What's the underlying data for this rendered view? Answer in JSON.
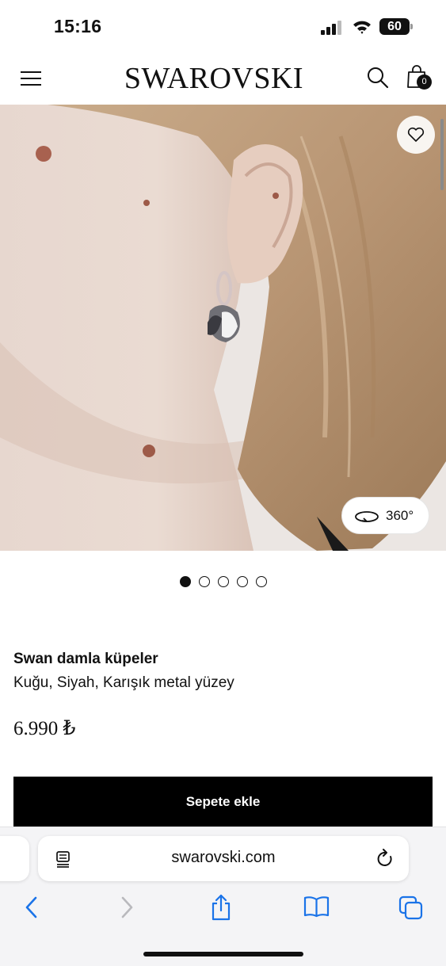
{
  "status_bar": {
    "time": "15:16",
    "battery": "60"
  },
  "header": {
    "brand": "SWAROVSKI",
    "cart_count": "0"
  },
  "gallery": {
    "view_360_label": "360°",
    "total_images": 5,
    "active_index": 0
  },
  "product": {
    "name": "Swan damla küpeler",
    "variant": "Kuğu, Siyah, Karışık metal yüzey",
    "price": "6.990 ₺"
  },
  "cta": {
    "add_to_cart_label": "Sepete ekle"
  },
  "browser": {
    "url": "swarovski.com"
  },
  "colors": {
    "primary": "#000000",
    "background": "#ffffff",
    "browser_bar": "#f4f4f6",
    "browser_accent": "#1a73e8"
  }
}
